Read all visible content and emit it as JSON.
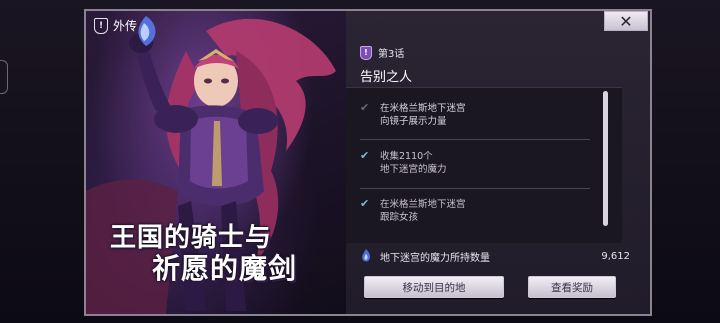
{
  "art": {
    "category_badge": "!",
    "category_label": "外传",
    "title_line1": "王国的骑士与",
    "title_line2": "祈愿的魔剑"
  },
  "panel": {
    "close_label": "✕",
    "chapter_badge": "!",
    "chapter_label": "第3话",
    "story_title": "告别之人",
    "objectives": [
      {
        "line1": "在米格兰斯地下迷宫",
        "line2": "向镜子展示力量",
        "state": "current"
      },
      {
        "line1": "收集2110个",
        "line2": "地下迷宫的魔力",
        "state": "done"
      },
      {
        "line1": "在米格兰斯地下迷宫",
        "line2": "跟踪女孩",
        "state": "done"
      }
    ],
    "mana_label": "地下迷宫的魔力所持数量",
    "mana_value": "9,612",
    "move_button": "移动到目的地",
    "rewards_button": "查看奖励"
  },
  "colors": {
    "accent_purple": "#7d4fb1",
    "check_blue": "#7db6e0",
    "panel_bg": "#2a2433"
  },
  "icons": [
    "shield-badge-icon",
    "close-icon",
    "chapter-badge-icon",
    "checkmark-icon",
    "blue-flame-icon"
  ]
}
